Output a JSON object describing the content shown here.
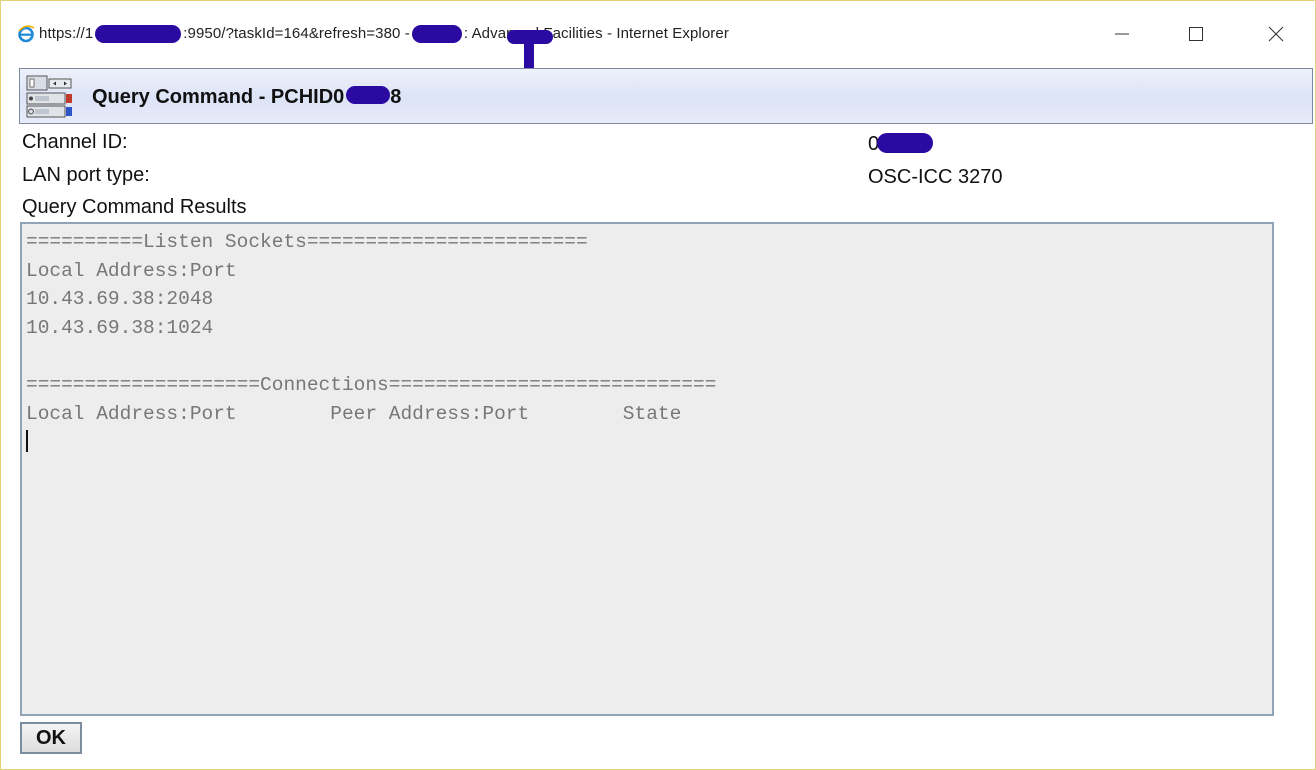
{
  "window": {
    "title_prefix": "https://1",
    "title_mid": ":9950/?taskId=164&refresh=380 -",
    "title_suffix": ": Advanced Facilities - Internet Explorer",
    "minimize_glyph": "—",
    "maximize_glyph": "☐",
    "close_glyph": "✕"
  },
  "panel": {
    "title": "Query Command - PCHID0",
    "title_tail": "8"
  },
  "fields": {
    "channel_id_label": "Channel ID:",
    "channel_id_value": "0",
    "lan_port_type_label": "LAN port type:",
    "lan_port_type_value": "OSC-ICC 3270",
    "results_label": "Query Command Results"
  },
  "results": {
    "text": "==========Listen Sockets========================\nLocal Address:Port\n10.43.69.38:2048\n10.43.69.38:1024\n\n====================Connections============================\nLocal Address:Port        Peer Address:Port        State"
  },
  "buttons": {
    "ok_label": "OK"
  },
  "icons": {
    "browser": "internet-explorer-icon",
    "panel": "hardware-channel-icon"
  },
  "colors": {
    "redaction": "#2a0aa0",
    "panel_header_bg": "#dce3f6",
    "results_bg": "#ededed",
    "results_text": "#777777"
  }
}
